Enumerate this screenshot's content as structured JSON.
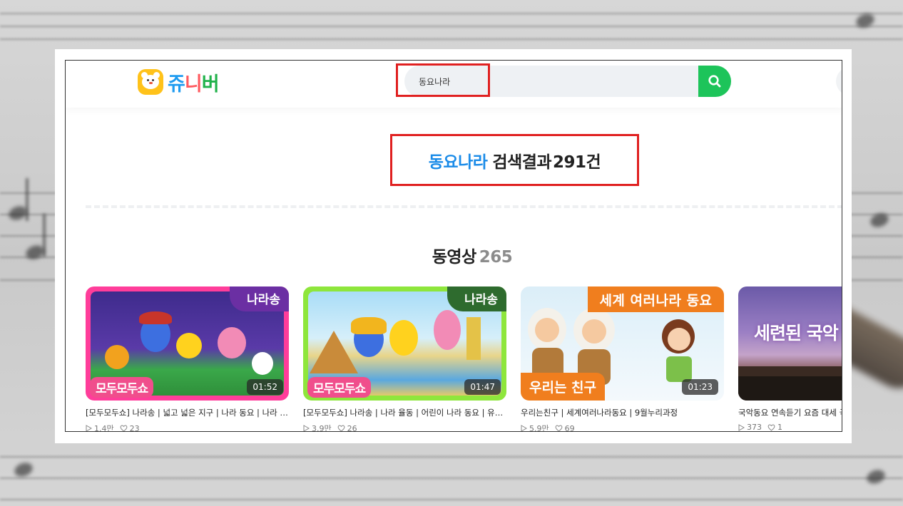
{
  "logo": {
    "text_1": "쥬",
    "text_2": "니",
    "text_3": "버"
  },
  "search": {
    "query": "동요나라",
    "icon": "search-icon"
  },
  "result": {
    "keyword": "동요나라",
    "label": "검색결과",
    "count": "291건"
  },
  "section": {
    "title": "동영상",
    "count": "265"
  },
  "videos": [
    {
      "tag": "나라송",
      "show": "모두모두쇼",
      "duration": "01:52",
      "title": "[모두모두쇼] 나라송 | 넓고 넓은 지구 | 나라 동요 | 나라 …",
      "views": "1.4만",
      "likes": "23"
    },
    {
      "tag": "나라송",
      "show": "모두모두쇼",
      "duration": "01:47",
      "title": "[모두모두쇼] 나라송 | 나라 율동 | 어린이 나라 동요 | 유…",
      "views": "3.9만",
      "likes": "26"
    },
    {
      "tag": "세계 여러나라 동요",
      "tag_bottom": "우리는 친구",
      "duration": "01:23",
      "title": "우리는친구 | 세계여러나라동요 | 9월누리과정",
      "views": "5.9만",
      "likes": "69"
    },
    {
      "art_text": "세련된 국악",
      "title": "국악동요 연속듣기 요즘 대세 국",
      "views": "373",
      "likes": "1"
    }
  ],
  "colors": {
    "accent": "#1dc45a",
    "keyword": "#1a8be8",
    "highlight": "#e02020"
  }
}
